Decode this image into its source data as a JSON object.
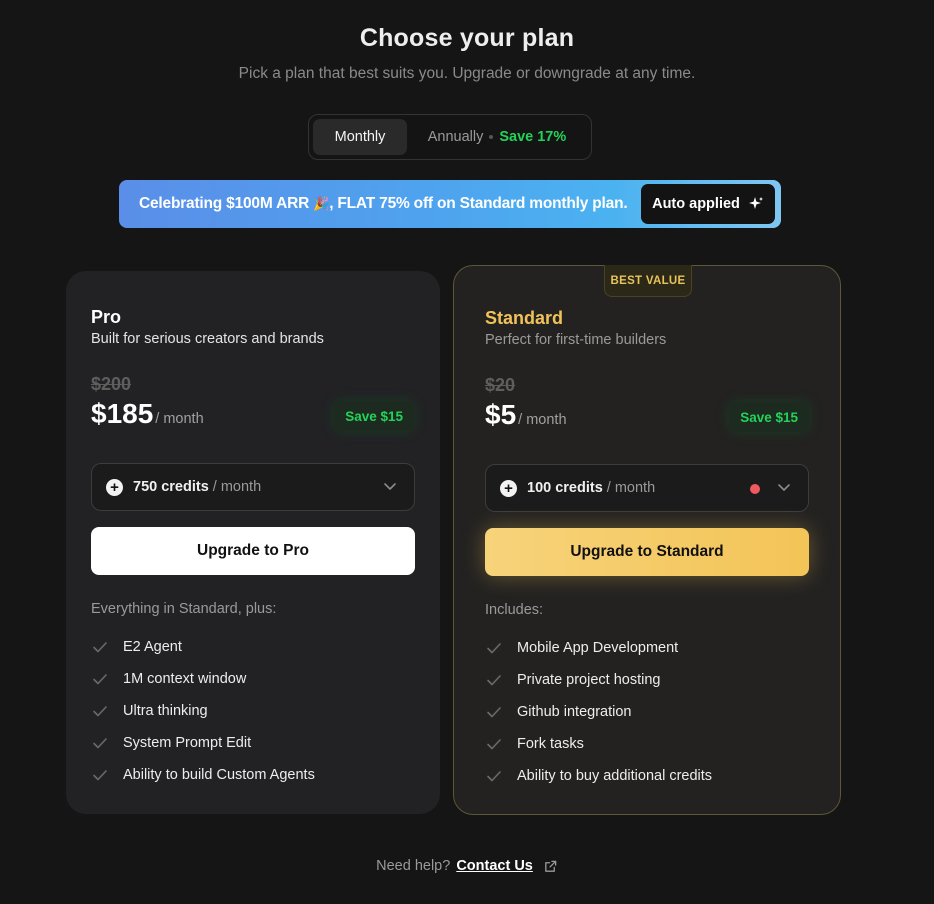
{
  "header": {
    "title": "Choose your plan",
    "subtitle": "Pick a plan that best suits you. Upgrade or downgrade at any time."
  },
  "billing_toggle": {
    "monthly_label": "Monthly",
    "annual_label": "Annually",
    "annual_save": "Save 17%",
    "selected": "Monthly"
  },
  "banner": {
    "text": "Celebrating $100M ARR",
    "emoji": "🎉",
    "text2": ", FLAT 75% off on Standard monthly plan.",
    "button_label": "Auto applied"
  },
  "plans": [
    {
      "name": "Pro",
      "description": "Built for serious creators and brands",
      "old_price": "$200",
      "price": "$185",
      "price_unit": "/ month",
      "save": "Save $15",
      "credits_value": "750 credits",
      "credits_unit": "/ month",
      "cta": "Upgrade to Pro",
      "features_heading": "Everything in Standard, plus:",
      "features": [
        "E2 Agent",
        "1M context window",
        "Ultra thinking",
        "System Prompt Edit",
        "Ability to build Custom Agents"
      ]
    },
    {
      "name": "Standard",
      "badge": "BEST VALUE",
      "description": "Perfect for first-time builders",
      "old_price": "$20",
      "price": "$5",
      "price_unit": "/ month",
      "save": "Save $15",
      "credits_value": "100 credits",
      "credits_unit": "/ month",
      "cta": "Upgrade to Standard",
      "features_heading": "Includes:",
      "features": [
        "Mobile App Development",
        "Private project hosting",
        "Github integration",
        "Fork tasks",
        "Ability to buy additional credits"
      ]
    }
  ],
  "footer": {
    "help_text": "Need help?",
    "contact_label": "Contact Us"
  },
  "colors": {
    "background": "#151515",
    "accent_gold": "#f2c25a",
    "save_green": "#22d35a",
    "banner_blue": "#4fa2ee"
  }
}
